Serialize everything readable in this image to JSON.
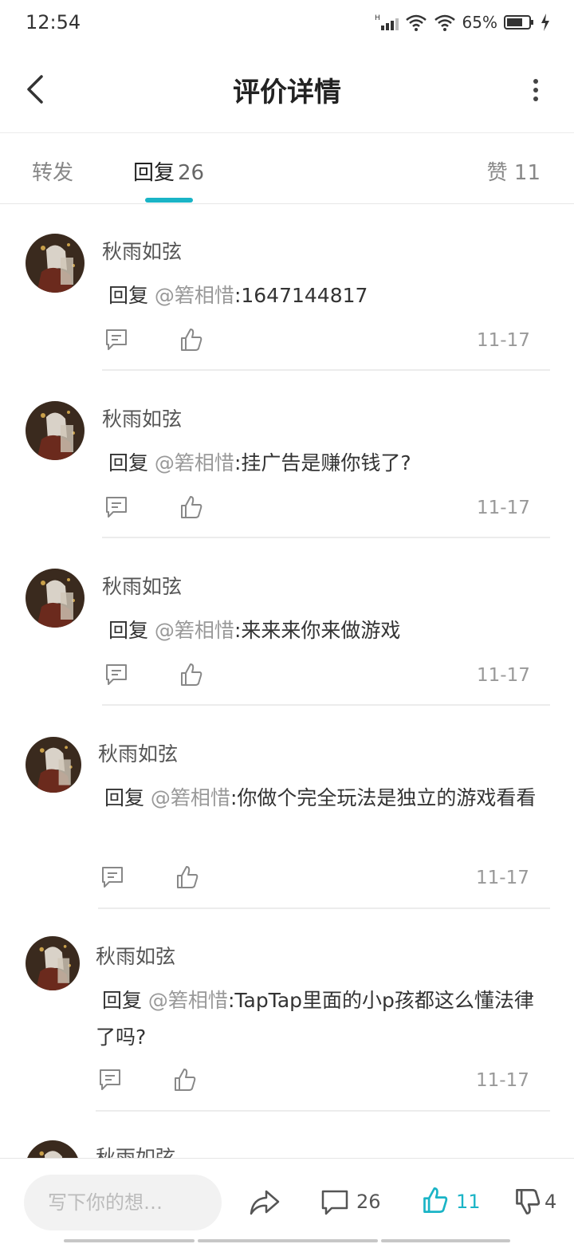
{
  "status_bar": {
    "time": "12:54",
    "battery": "65%"
  },
  "header": {
    "title": "评价详情"
  },
  "tabs": {
    "forward": "转发",
    "reply_label": "回复",
    "reply_count": "26",
    "like_label": "赞",
    "like_count": "11"
  },
  "replies": [
    {
      "user": "秋雨如弦",
      "prefix": "回复",
      "mention": "@箬相惜",
      "text": ":1647144817",
      "date": "11-17"
    },
    {
      "user": "秋雨如弦",
      "prefix": "回复",
      "mention": "@箬相惜",
      "text": ":挂广告是赚你钱了?",
      "date": "11-17"
    },
    {
      "user": "秋雨如弦",
      "prefix": "回复",
      "mention": "@箬相惜",
      "text": ":来来来你来做游戏",
      "date": "11-17"
    },
    {
      "user": "秋雨如弦",
      "prefix": "回复",
      "mention": "@箬相惜",
      "text": ":你做个完全玩法是独立的游戏看看",
      "date": "11-17"
    },
    {
      "user": "秋雨如弦",
      "prefix": "回复",
      "mention": "@箬相惜",
      "text": ":TapTap里面的小p孩都这么懂法律了吗?",
      "date": "11-17"
    },
    {
      "user": "秋雨如弦"
    }
  ],
  "bottom_bar": {
    "input_placeholder": "写下你的想…",
    "comment_count": "26",
    "like_count": "11",
    "dislike_count": "4"
  },
  "colors": {
    "accent": "#1ab4c6",
    "muted": "#999999"
  }
}
